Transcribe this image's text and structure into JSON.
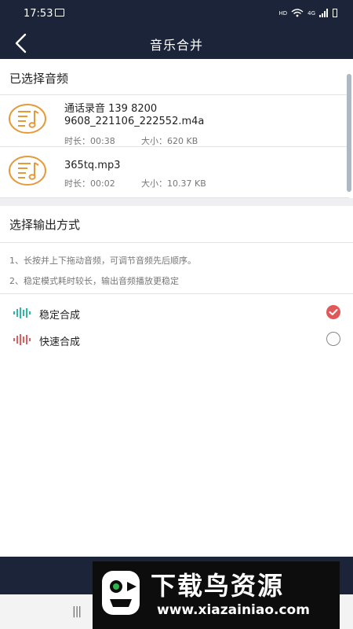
{
  "status_bar": {
    "time": "17:53",
    "indicators": [
      "HD",
      "4G"
    ],
    "icons": [
      "gallery-icon",
      "wifi-icon",
      "signal-icon",
      "battery-icon"
    ]
  },
  "header": {
    "title": "音乐合并",
    "back_icon": "chevron-left-icon"
  },
  "selected_section": {
    "title": "已选择音频",
    "files": [
      {
        "name": "通话录音 139 8200\n9608_221106_222552.m4a",
        "duration": "时长：00:38",
        "size": "大小：620 KB"
      },
      {
        "name": "365tq.mp3",
        "duration": "时长：00:02",
        "size": "大小：10.37 KB"
      }
    ]
  },
  "output_section": {
    "title": "选择输出方式",
    "tips": [
      "1、长按并上下拖动音频，可调节音频先后顺序。",
      "2、稳定模式耗时较长，输出音频播放更稳定"
    ],
    "options": [
      {
        "label": "稳定合成",
        "selected": true,
        "icon_color": "#2fb6a6"
      },
      {
        "label": "快速合成",
        "selected": false,
        "icon_color": "#e06060"
      }
    ]
  },
  "colors": {
    "header_bg": "#1b2438",
    "accent_orange": "#e59a3a",
    "check_red": "#e25757"
  },
  "watermark": {
    "title": "下载鸟资源",
    "url": "www.xiazainiao.com"
  },
  "nav_bar": {
    "recent_icon": "|||"
  }
}
